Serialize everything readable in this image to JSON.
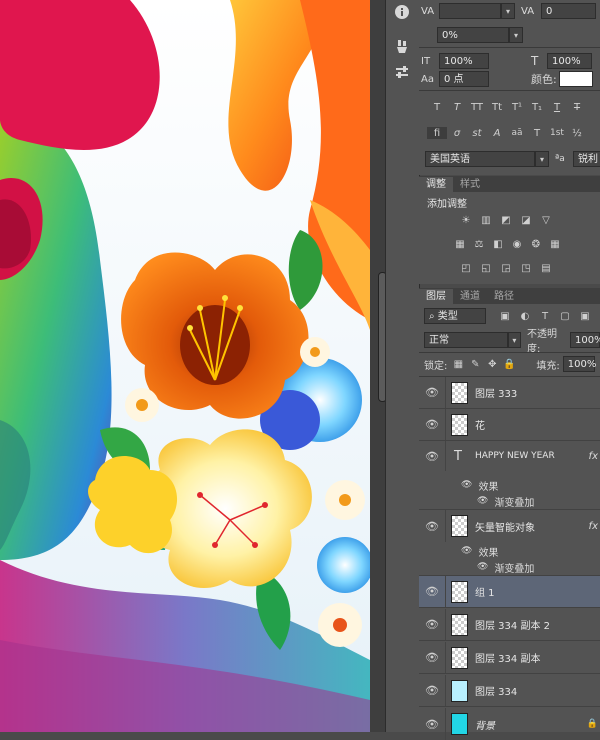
{
  "toolstrip": {
    "items": [
      "info-icon",
      "brush-preset-icon",
      "sliders-icon"
    ]
  },
  "character": {
    "kerning_label": "VA",
    "kerning_value": "",
    "tracking_label": "VA",
    "tracking_value": "0",
    "scale_vert_value": "0%",
    "vscale_label": "IT",
    "vscale_value": "100%",
    "hscale_label": "T",
    "hscale_value": "100%",
    "baseline_label": "Aa",
    "baseline_value": "0 点",
    "color_label": "颜色:",
    "style_buttons": [
      "T",
      "T",
      "TT",
      "Tt",
      "T¹",
      "T₁",
      "T",
      "T"
    ],
    "opentype_buttons": [
      "fi",
      "σ",
      "st",
      "A",
      "aā",
      "T",
      "1st",
      "½"
    ],
    "language": "美国英语",
    "aa_label": "ªa",
    "antialias": "锐利"
  },
  "adjustments": {
    "tabs": [
      "调整",
      "样式"
    ],
    "title": "添加调整"
  },
  "layers_panel": {
    "tabs": [
      "图层",
      "通道",
      "路径"
    ],
    "filter_kind": "类型",
    "blend_mode": "正常",
    "opacity_label": "不透明度:",
    "opacity_value": "100%",
    "lock_label": "锁定:",
    "fill_label": "填充:",
    "fill_value": "100%",
    "layers": [
      {
        "name": "图层 333"
      },
      {
        "name": "花"
      },
      {
        "name": "HAPPY NEW YEAR",
        "fx": "fx"
      },
      {
        "name": "效果"
      },
      {
        "name": "渐变叠加"
      },
      {
        "name": "矢量智能对象",
        "fx": "fx"
      },
      {
        "name": "效果"
      },
      {
        "name": "渐变叠加"
      },
      {
        "name": "组 1"
      },
      {
        "name": "图层 334 副本 2"
      },
      {
        "name": "图层 334 副本"
      },
      {
        "name": "图层 334"
      },
      {
        "name": "背景"
      }
    ]
  },
  "colors": {
    "panel_bg": "#535353",
    "selected_layer": "#5d6677",
    "canvas_bg": "#f2f7fb"
  }
}
